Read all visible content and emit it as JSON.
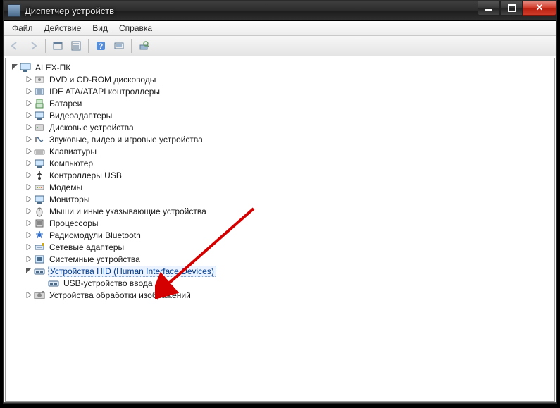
{
  "window": {
    "title": "Диспетчер устройств"
  },
  "menu": {
    "file": "Файл",
    "action": "Действие",
    "view": "Вид",
    "help": "Справка"
  },
  "tree": {
    "root": "ALEX-ПК",
    "items": [
      "DVD и CD-ROM дисководы",
      "IDE ATA/ATAPI контроллеры",
      "Батареи",
      "Видеоадаптеры",
      "Дисковые устройства",
      "Звуковые, видео и игровые устройства",
      "Клавиатуры",
      "Компьютер",
      "Контроллеры USB",
      "Модемы",
      "Мониторы",
      "Мыши и иные указывающие устройства",
      "Процессоры",
      "Радиомодули Bluetooth",
      "Сетевые адаптеры",
      "Системные устройства"
    ],
    "hid": {
      "label": "Устройства HID (Human Interface Devices)",
      "child": "USB-устройство ввода"
    },
    "imaging": "Устройства обработки изображений"
  }
}
